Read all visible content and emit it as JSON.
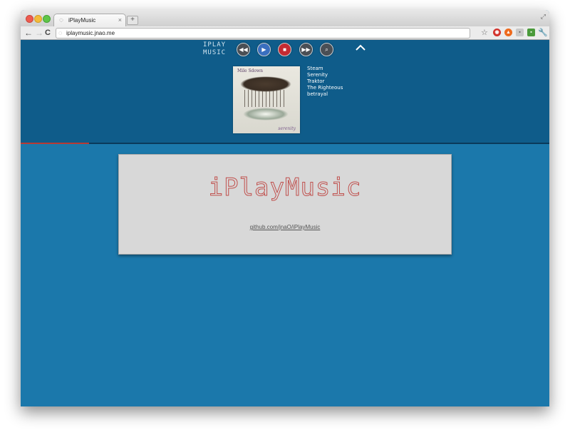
{
  "browser": {
    "tab_title": "iPlayMusic",
    "tab_close": "×",
    "new_tab": "+",
    "url": "iplaymusic.jnao.me",
    "nav_back": "←",
    "nav_forward": "→",
    "nav_reload": "C",
    "star": "☆",
    "wrench": "🔧",
    "resize": "⤢"
  },
  "player": {
    "logo_line1": "IPLAY",
    "logo_line2": "MUSIC",
    "controls": {
      "prev": "◀◀",
      "play": "▶",
      "stop": "■",
      "next": "▶▶",
      "search": "⌕"
    },
    "progress": 0.13,
    "album": {
      "artist_art_text": "Mile Sdown",
      "cursive_art_text": "serenity"
    },
    "now_playing": [
      "Steam",
      "Serenity",
      "Traktor",
      "The Righteous",
      "betrayal"
    ]
  },
  "main": {
    "title": "iPlayMusic",
    "link": "github.com/jnaO/iPlayMusic"
  },
  "colors": {
    "page_bg": "#1b78ab",
    "player_bg": "#0f5c8a",
    "progress": "#b83a34",
    "card_bg": "#d8d8d8",
    "title_dots": "#c0504d"
  }
}
